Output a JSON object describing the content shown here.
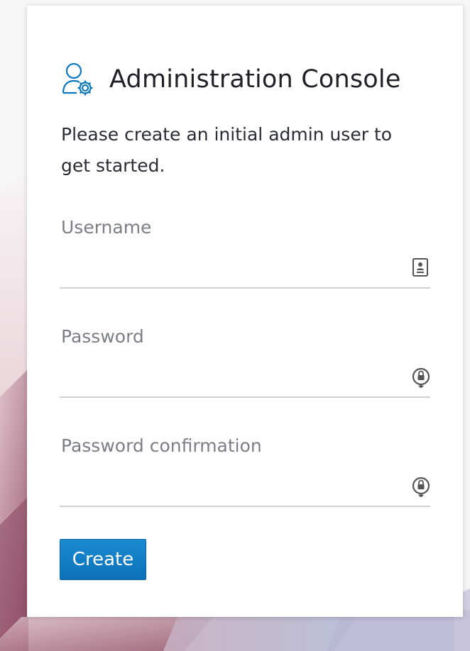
{
  "header": {
    "title": "Administration Console",
    "icon": "user-cog-icon"
  },
  "subtitle": "Please create an initial admin user to get started.",
  "form": {
    "username": {
      "label": "Username",
      "value": "",
      "icon": "id-card-icon"
    },
    "password": {
      "label": "Password",
      "value": "",
      "icon": "lock-key-icon"
    },
    "password_confirmation": {
      "label": "Password confirmation",
      "value": "",
      "icon": "lock-key-icon"
    },
    "submit_label": "Create"
  },
  "colors": {
    "accent": "#0d78be",
    "title": "#1f2126",
    "label": "#7b7e85",
    "underline": "#cfd1d4"
  }
}
